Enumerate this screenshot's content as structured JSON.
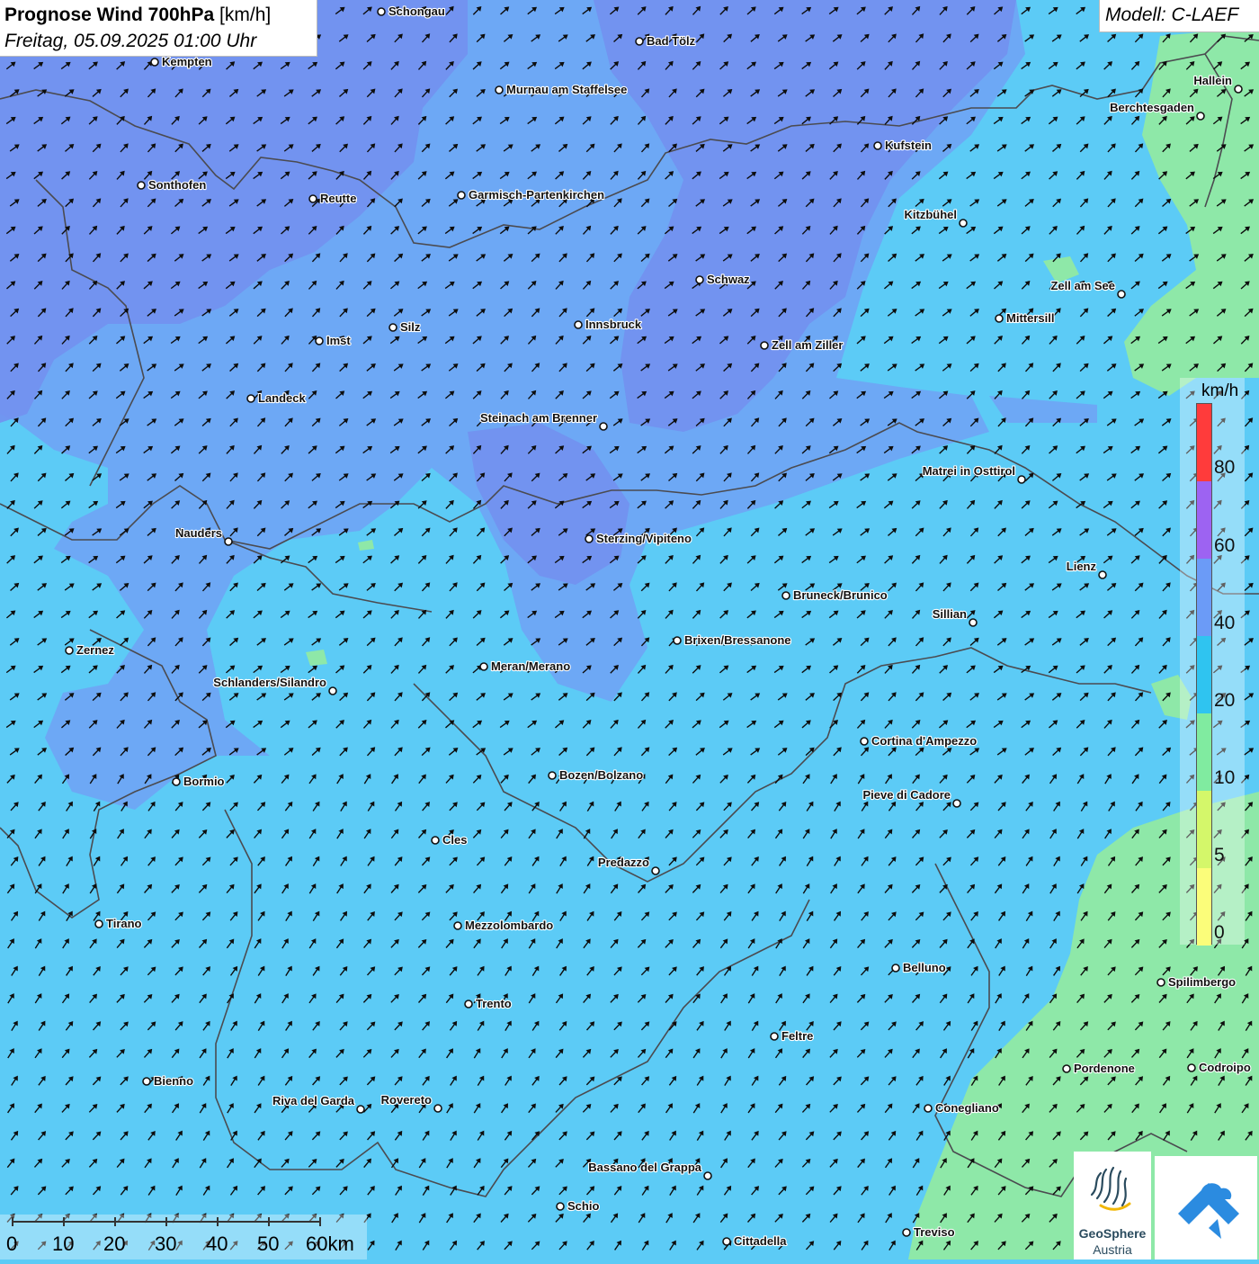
{
  "header": {
    "title_main": "Prognose Wind 700hPa",
    "title_unit": "[km/h]",
    "datetime": "Freitag, 05.09.2025 01:00 Uhr",
    "model": "Modell: C-LAEF"
  },
  "legend": {
    "unit": "km/h",
    "ticks": [
      "80",
      "60",
      "40",
      "20",
      "10",
      "5",
      "0"
    ],
    "colors": [
      "#ff3b3b",
      "#9d63f2",
      "#6b9bf7",
      "#2fc4f0",
      "#80eba0",
      "#d4f76a",
      "#fbfd7a"
    ]
  },
  "scalebar": {
    "labels": [
      "0",
      "10",
      "20",
      "30",
      "40",
      "50",
      "60km"
    ]
  },
  "logos": {
    "geosphere_line1": "GeoSphere",
    "geosphere_line2": "Austria"
  },
  "map": {
    "wind_direction": "south-west",
    "colors": {
      "base": "#5ccbf6",
      "mid": "#6da8f5",
      "strong": "#7290f0",
      "weak": "#8ee8a8"
    },
    "cities": [
      {
        "name": "Schongau"
      },
      {
        "name": "Bad Tölz"
      },
      {
        "name": "Kempten"
      },
      {
        "name": "Murnau am Staffelsee"
      },
      {
        "name": "Hallein"
      },
      {
        "name": "Berchtesgaden"
      },
      {
        "name": "Kufstein"
      },
      {
        "name": "Sonthofen"
      },
      {
        "name": "Reutte"
      },
      {
        "name": "Garmisch-Partenkirchen"
      },
      {
        "name": "Kitzbühel"
      },
      {
        "name": "Schwaz"
      },
      {
        "name": "Zell am See"
      },
      {
        "name": "Mittersill"
      },
      {
        "name": "Innsbruck"
      },
      {
        "name": "Imst"
      },
      {
        "name": "Silz"
      },
      {
        "name": "Zell am Ziller"
      },
      {
        "name": "Landeck"
      },
      {
        "name": "Steinach am Brenner"
      },
      {
        "name": "Matrei in Osttirol"
      },
      {
        "name": "Nauders"
      },
      {
        "name": "Sterzing/Vipiteno"
      },
      {
        "name": "Lienz"
      },
      {
        "name": "Bruneck/Brunico"
      },
      {
        "name": "Sillian"
      },
      {
        "name": "Brixen/Bressanone"
      },
      {
        "name": "Zernez"
      },
      {
        "name": "Meran/Merano"
      },
      {
        "name": "Schlanders/Silandro"
      },
      {
        "name": "Cortina d'Ampezzo"
      },
      {
        "name": "Bozen/Bolzano"
      },
      {
        "name": "Bormio"
      },
      {
        "name": "Pieve di Cadore"
      },
      {
        "name": "Cles"
      },
      {
        "name": "Predazzo"
      },
      {
        "name": "Tirano"
      },
      {
        "name": "Mezzolombardo"
      },
      {
        "name": "Belluno"
      },
      {
        "name": "Spilimbergo"
      },
      {
        "name": "Trento"
      },
      {
        "name": "Feltre"
      },
      {
        "name": "Bienno"
      },
      {
        "name": "Pordenone"
      },
      {
        "name": "Codroipo"
      },
      {
        "name": "Riva del Garda"
      },
      {
        "name": "Rovereto"
      },
      {
        "name": "Conegliano"
      },
      {
        "name": "Bassano del Grappa"
      },
      {
        "name": "Schio"
      },
      {
        "name": "Treviso"
      },
      {
        "name": "Cittadella"
      }
    ]
  }
}
